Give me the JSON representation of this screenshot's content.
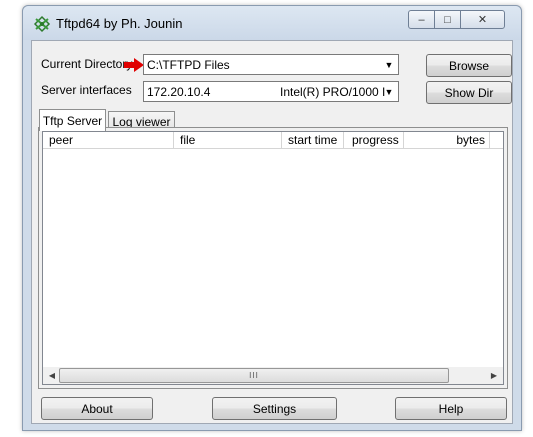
{
  "window": {
    "title": "Tftpd64 by Ph. Jounin",
    "controls": {
      "minimize": "–",
      "maximize": "□",
      "close": "✕"
    }
  },
  "form": {
    "current_directory_label": "Current Directory",
    "current_directory_value": "C:\\TFTPD Files",
    "server_interfaces_label": "Server interfaces",
    "server_interface_ip": "172.20.10.4",
    "server_interface_adapter": "Intel(R) PRO/1000 I",
    "browse_label": "Browse",
    "show_dir_label": "Show Dir",
    "arrow_color": "#e00000"
  },
  "tabs": [
    {
      "label": "Tftp Server",
      "active": true
    },
    {
      "label": "Log viewer",
      "active": false
    }
  ],
  "table": {
    "columns": [
      "peer",
      "file",
      "start time",
      "progress",
      "bytes"
    ],
    "rows": []
  },
  "scrollbar": {
    "left": "◀",
    "right": "▶",
    "grip": "III"
  },
  "footer": {
    "about_label": "About",
    "settings_label": "Settings",
    "help_label": "Help"
  }
}
